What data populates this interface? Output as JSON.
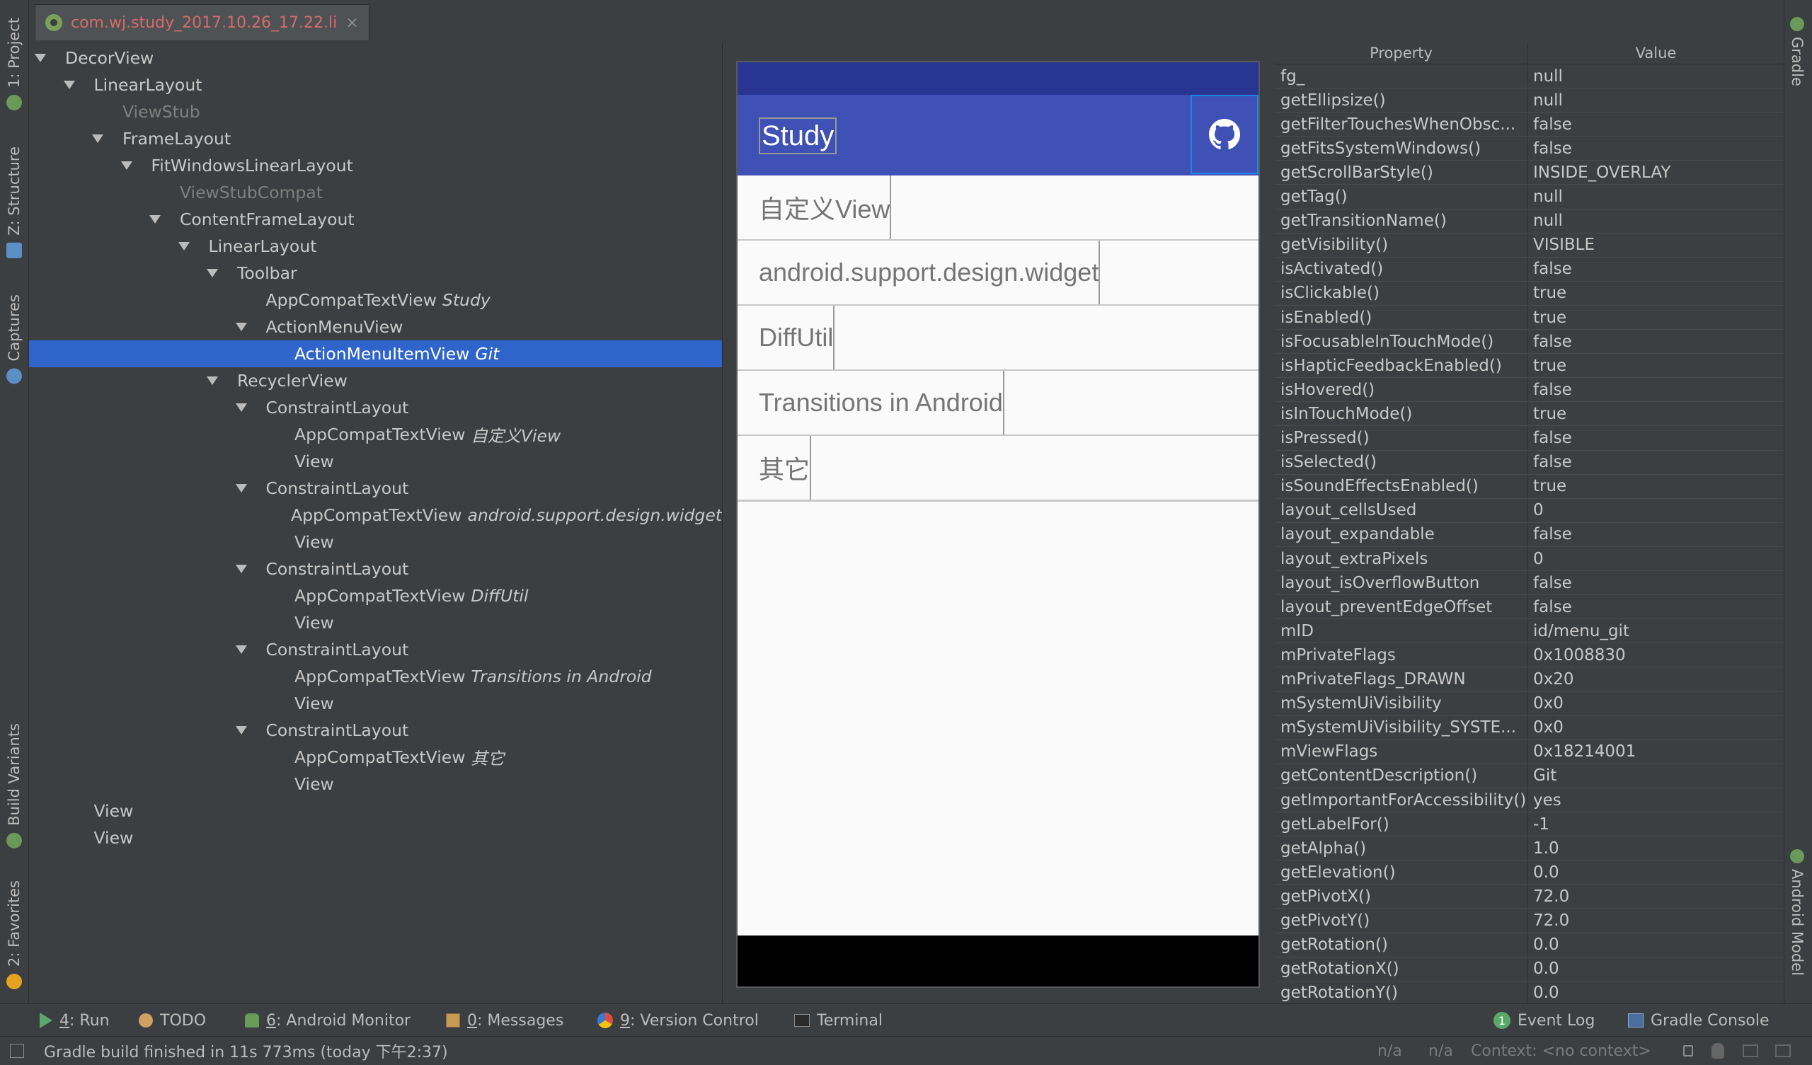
{
  "editor_tab": {
    "title": "com.wj.study_2017.10.26_17.22.li",
    "close_glyph": "×"
  },
  "left_strip": [
    "1: Project",
    "Z: Structure",
    "Captures",
    "Build Variants",
    "2: Favorites"
  ],
  "right_strip": [
    "Gradle",
    "Android Model"
  ],
  "tree": [
    {
      "label": "DecorView",
      "depth": 0,
      "expanded": true
    },
    {
      "label": "LinearLayout",
      "depth": 1,
      "expanded": true
    },
    {
      "label": "ViewStub",
      "depth": 2,
      "dim": true
    },
    {
      "label": "FrameLayout",
      "depth": 2,
      "expanded": true
    },
    {
      "label": "FitWindowsLinearLayout",
      "depth": 3,
      "expanded": true
    },
    {
      "label": "ViewStubCompat",
      "depth": 4,
      "dim": true
    },
    {
      "label": "ContentFrameLayout",
      "depth": 4,
      "expanded": true
    },
    {
      "label": "LinearLayout",
      "depth": 5,
      "expanded": true
    },
    {
      "label": "Toolbar",
      "depth": 6,
      "expanded": true
    },
    {
      "label": "AppCompatTextView",
      "sub": "Study",
      "depth": 7
    },
    {
      "label": "ActionMenuView",
      "depth": 7,
      "expanded": true
    },
    {
      "label": "ActionMenuItemView",
      "sub": "Git",
      "depth": 8,
      "selected": true
    },
    {
      "label": "RecyclerView",
      "depth": 6,
      "expanded": true
    },
    {
      "label": "ConstraintLayout",
      "depth": 7,
      "expanded": true
    },
    {
      "label": "AppCompatTextView",
      "sub": "自定义View",
      "depth": 8
    },
    {
      "label": "View",
      "depth": 8
    },
    {
      "label": "ConstraintLayout",
      "depth": 7,
      "expanded": true
    },
    {
      "label": "AppCompatTextView",
      "sub": "android.support.design.widget",
      "depth": 8
    },
    {
      "label": "View",
      "depth": 8
    },
    {
      "label": "ConstraintLayout",
      "depth": 7,
      "expanded": true
    },
    {
      "label": "AppCompatTextView",
      "sub": "DiffUtil",
      "depth": 8
    },
    {
      "label": "View",
      "depth": 8
    },
    {
      "label": "ConstraintLayout",
      "depth": 7,
      "expanded": true
    },
    {
      "label": "AppCompatTextView",
      "sub": "Transitions in Android",
      "depth": 8
    },
    {
      "label": "View",
      "depth": 8
    },
    {
      "label": "ConstraintLayout",
      "depth": 7,
      "expanded": true
    },
    {
      "label": "AppCompatTextView",
      "sub": "其它",
      "depth": 8
    },
    {
      "label": "View",
      "depth": 8
    },
    {
      "label": "View",
      "depth": 1
    },
    {
      "label": "View",
      "depth": 1
    }
  ],
  "device": {
    "toolbar_title": "Study",
    "colors": {
      "status": "#283593",
      "toolbar": "#3f51b5",
      "nav": "#000000"
    },
    "items": [
      "自定义View",
      "android.support.design.widget",
      "DiffUtil",
      "Transitions in Android",
      "其它"
    ]
  },
  "properties": {
    "header": {
      "property": "Property",
      "value": "Value"
    },
    "rows": [
      {
        "name": "fg_",
        "value": "null"
      },
      {
        "name": "getEllipsize()",
        "value": "null"
      },
      {
        "name": "getFilterTouchesWhenObsc...",
        "value": "false"
      },
      {
        "name": "getFitsSystemWindows()",
        "value": "false"
      },
      {
        "name": "getScrollBarStyle()",
        "value": "INSIDE_OVERLAY"
      },
      {
        "name": "getTag()",
        "value": "null"
      },
      {
        "name": "getTransitionName()",
        "value": "null"
      },
      {
        "name": "getVisibility()",
        "value": "VISIBLE"
      },
      {
        "name": "isActivated()",
        "value": "false"
      },
      {
        "name": "isClickable()",
        "value": "true"
      },
      {
        "name": "isEnabled()",
        "value": "true"
      },
      {
        "name": "isFocusableInTouchMode()",
        "value": "false"
      },
      {
        "name": "isHapticFeedbackEnabled()",
        "value": "true"
      },
      {
        "name": "isHovered()",
        "value": "false"
      },
      {
        "name": "isInTouchMode()",
        "value": "true"
      },
      {
        "name": "isPressed()",
        "value": "false"
      },
      {
        "name": "isSelected()",
        "value": "false"
      },
      {
        "name": "isSoundEffectsEnabled()",
        "value": "true"
      },
      {
        "name": "layout_cellsUsed",
        "value": "0"
      },
      {
        "name": "layout_expandable",
        "value": "false"
      },
      {
        "name": "layout_extraPixels",
        "value": "0"
      },
      {
        "name": "layout_isOverflowButton",
        "value": "false"
      },
      {
        "name": "layout_preventEdgeOffset",
        "value": "false"
      },
      {
        "name": "mID",
        "value": "id/menu_git"
      },
      {
        "name": "mPrivateFlags",
        "value": "0x1008830"
      },
      {
        "name": "mPrivateFlags_DRAWN",
        "value": "0x20"
      },
      {
        "name": "mSystemUiVisibility",
        "value": "0x0"
      },
      {
        "name": "mSystemUiVisibility_SYSTE...",
        "value": "0x0"
      },
      {
        "name": "mViewFlags",
        "value": "0x18214001"
      },
      {
        "name": "getContentDescription()",
        "value": "Git"
      },
      {
        "name": "getImportantForAccessibility()",
        "value": "yes"
      },
      {
        "name": "getLabelFor()",
        "value": "-1"
      },
      {
        "name": "getAlpha()",
        "value": "1.0"
      },
      {
        "name": "getElevation()",
        "value": "0.0"
      },
      {
        "name": "getPivotX()",
        "value": "72.0"
      },
      {
        "name": "getPivotY()",
        "value": "72.0"
      },
      {
        "name": "getRotation()",
        "value": "0.0"
      },
      {
        "name": "getRotationX()",
        "value": "0.0"
      },
      {
        "name": "getRotationY()",
        "value": "0.0"
      }
    ]
  },
  "bottom_tools": {
    "run": {
      "num": "4",
      "rest": ": Run"
    },
    "todo": "TODO",
    "android_monitor": {
      "num": "6",
      "rest": ": Android Monitor"
    },
    "messages": {
      "num": "0",
      "rest": ": Messages"
    },
    "version_control": {
      "num": "9",
      "rest": ": Version Control"
    },
    "terminal": "Terminal",
    "event_log": "Event Log",
    "event_log_badge": "1",
    "gradle_console": "Gradle Console"
  },
  "status": {
    "message": "Gradle build finished in 11s 773ms (today 下午2:37)",
    "na1": "n/a",
    "na2": "n/a",
    "context": "Context: <no context>"
  }
}
